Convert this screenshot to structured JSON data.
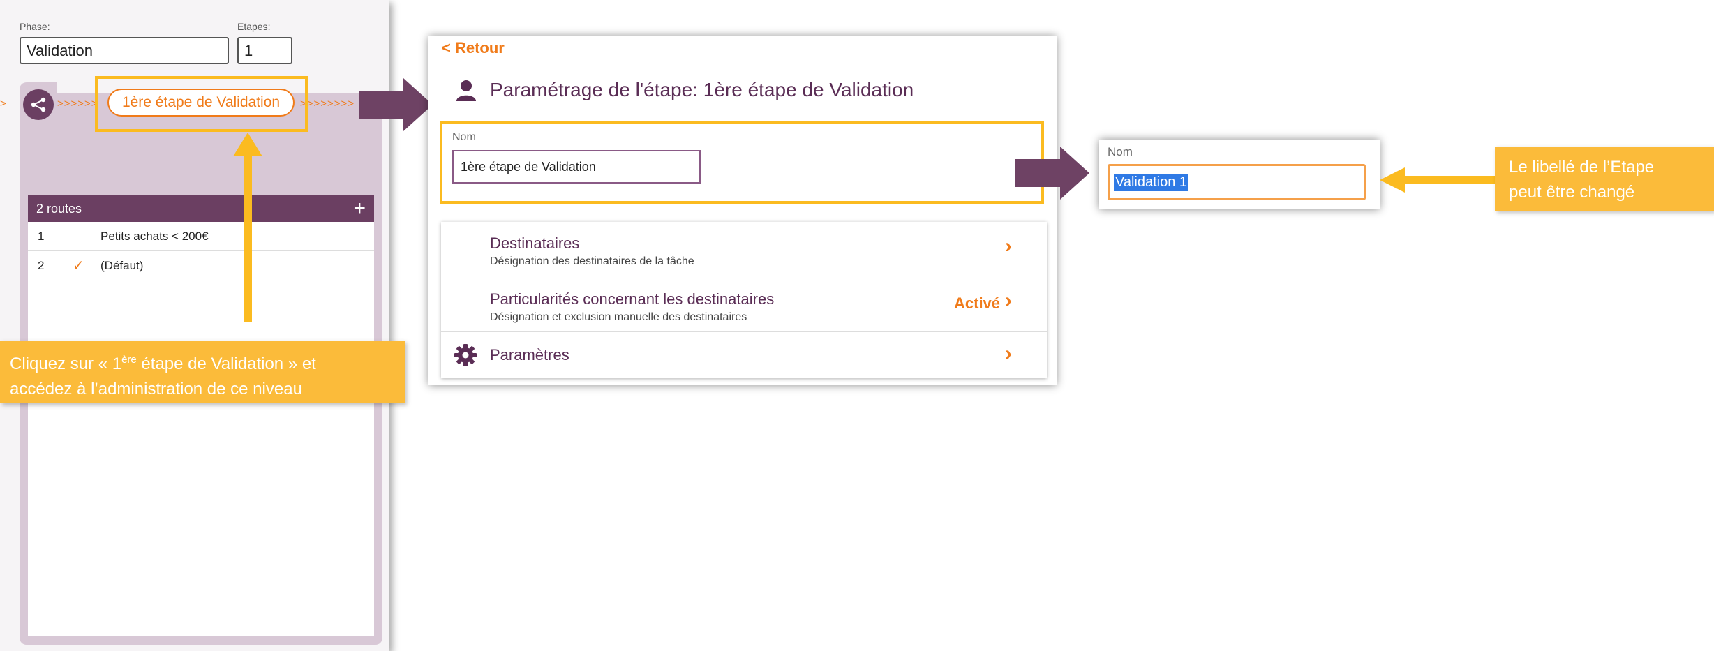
{
  "left": {
    "phase_label": "Phase:",
    "phase_value": "Validation",
    "etapes_label": "Etapes:",
    "etapes_value": "1",
    "chevrons_left": ">>>>>>",
    "chevrons_right": ">>>>>>>>",
    "step_pill": "1ère étape de Validation",
    "routes_header": "2 routes",
    "add_icon": "+",
    "routes": [
      {
        "num": "1",
        "check": "",
        "label": "Petits achats < 200€"
      },
      {
        "num": "2",
        "check": "✓",
        "label": "(Défaut)"
      }
    ]
  },
  "callout_left": {
    "prefix": "Cliquez sur « 1",
    "superscript": "ère",
    "suffix": " étape de Validation » et",
    "line2": "accédez à l’administration de ce niveau"
  },
  "middle": {
    "back_link": "< Retour",
    "title": "Paramétrage de l'étape: 1ère étape de Validation",
    "nom_label": "Nom",
    "nom_value": "1ère étape de Validation",
    "settings": [
      {
        "title": "Destinataires",
        "subtitle": "Désignation des destinataires de la tâche",
        "status": ""
      },
      {
        "title": "Particularités concernant les destinataires",
        "subtitle": "Désignation et exclusion manuelle des destinataires",
        "status": "Activé"
      },
      {
        "title": "Paramètres",
        "subtitle": "",
        "status": ""
      }
    ]
  },
  "right": {
    "nom_label": "Nom",
    "nom_value": "Validation 1"
  },
  "callout_right": {
    "line1": "Le libellé de l’Etape",
    "line2": "peut être changé"
  },
  "colors": {
    "accent_orange": "#f07b1a",
    "brand_purple": "#6b3f62",
    "callout_yellow": "#fbbb3a",
    "highlight_yellow": "#fbbb20",
    "arrow_purple": "#6e4264"
  },
  "icons": [
    "share-icon",
    "plus-icon",
    "check-icon",
    "person-icon",
    "chevron-right-icon",
    "gear-icon"
  ]
}
